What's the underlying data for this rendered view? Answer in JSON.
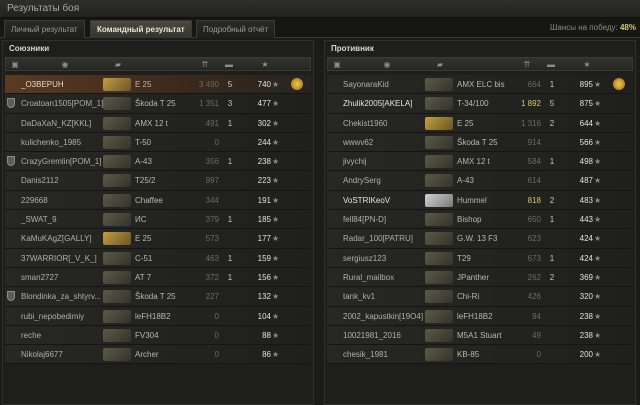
{
  "window": {
    "title": "Результаты боя"
  },
  "tabs": [
    {
      "label": "Личный результат"
    },
    {
      "label": "Командный результат"
    },
    {
      "label": "Подробный отчёт"
    }
  ],
  "win_chance": {
    "label": "Шансы на победу:",
    "value": "48%"
  },
  "allies": {
    "title": "Союзники",
    "header_icons": [
      "platoon-icon",
      "player-icon",
      "tank-icon",
      "damage-icon",
      "kills-icon",
      "experience-icon"
    ],
    "rows": [
      {
        "name": "_O3BEPUH",
        "vehicle": "E 25",
        "damage": "3 490",
        "kills": "5",
        "xp": "740",
        "platoon": false,
        "tank_style": "gold",
        "me": true,
        "medal": true
      },
      {
        "name": "Croatoan1505[POM_1]",
        "vehicle": "Škoda T 25",
        "damage": "1 351",
        "kills": "3",
        "xp": "477",
        "platoon": true,
        "tank_style": "normal"
      },
      {
        "name": "DaDaXaN_KZ[KKL]",
        "vehicle": "AMX 12 t",
        "damage": "491",
        "kills": "1",
        "xp": "302",
        "platoon": false,
        "tank_style": "normal"
      },
      {
        "name": "kulichenko_1985",
        "vehicle": "T-50",
        "damage": "0",
        "kills": "",
        "xp": "244",
        "platoon": false,
        "tank_style": "normal"
      },
      {
        "name": "CrazyGremlin[POM_1]",
        "vehicle": "A-43",
        "damage": "356",
        "kills": "1",
        "xp": "238",
        "platoon": true,
        "tank_style": "normal"
      },
      {
        "name": "Danis2112",
        "vehicle": "T25/2",
        "damage": "997",
        "kills": "",
        "xp": "223",
        "platoon": false,
        "tank_style": "normal"
      },
      {
        "name": "229668",
        "vehicle": "Chaffee",
        "damage": "344",
        "kills": "",
        "xp": "191",
        "platoon": false,
        "tank_style": "normal"
      },
      {
        "name": "_SWAT_9",
        "vehicle": "ИС",
        "damage": "379",
        "kills": "1",
        "xp": "185",
        "platoon": false,
        "tank_style": "normal"
      },
      {
        "name": "KaMuKAgZ[GALLY]",
        "vehicle": "E 25",
        "damage": "573",
        "kills": "",
        "xp": "177",
        "platoon": false,
        "tank_style": "gold"
      },
      {
        "name": "37WARRIOR[_V_K_]",
        "vehicle": "C-51",
        "damage": "463",
        "kills": "1",
        "xp": "159",
        "platoon": false,
        "tank_style": "normal"
      },
      {
        "name": "sman2727",
        "vehicle": "AT 7",
        "damage": "372",
        "kills": "1",
        "xp": "156",
        "platoon": false,
        "tank_style": "normal"
      },
      {
        "name": "Blondinka_za_shtyrv...",
        "vehicle": "Škoda T 25",
        "damage": "227",
        "kills": "",
        "xp": "132",
        "platoon": true,
        "tank_style": "normal"
      },
      {
        "name": "rubi_nepobedimiy",
        "vehicle": "leFH18B2",
        "damage": "0",
        "kills": "",
        "xp": "104",
        "platoon": false,
        "tank_style": "normal"
      },
      {
        "name": "reche",
        "vehicle": "FV304",
        "damage": "0",
        "kills": "",
        "xp": "88",
        "platoon": false,
        "tank_style": "normal"
      },
      {
        "name": "Nikolaj6677",
        "vehicle": "Archer",
        "damage": "0",
        "kills": "",
        "xp": "86",
        "platoon": false,
        "tank_style": "normal"
      }
    ]
  },
  "enemies": {
    "title": "Противник",
    "header_icons": [
      "platoon-icon",
      "player-icon",
      "tank-icon",
      "damage-icon",
      "kills-icon",
      "experience-icon"
    ],
    "rows": [
      {
        "name": "SayonaraKid",
        "vehicle": "AMX ELC bis",
        "damage": "664",
        "kills": "1",
        "xp": "895",
        "platoon": false,
        "tank_style": "normal",
        "medal": true
      },
      {
        "name": "Zhulik2005[AKELA]",
        "vehicle": "T-34/100",
        "damage": "1 892",
        "kills": "5",
        "xp": "875",
        "platoon": false,
        "tank_style": "normal",
        "bright": true,
        "dmg_hl": true
      },
      {
        "name": "Chekist1960",
        "vehicle": "E 25",
        "damage": "1 316",
        "kills": "2",
        "xp": "644",
        "platoon": false,
        "tank_style": "gold"
      },
      {
        "name": "wwwv62",
        "vehicle": "Škoda T 25",
        "damage": "914",
        "kills": "",
        "xp": "566",
        "platoon": false,
        "tank_style": "normal"
      },
      {
        "name": "jivychij",
        "vehicle": "AMX 12 t",
        "damage": "584",
        "kills": "1",
        "xp": "498",
        "platoon": false,
        "tank_style": "normal"
      },
      {
        "name": "AndrySerg",
        "vehicle": "A-43",
        "damage": "614",
        "kills": "",
        "xp": "487",
        "platoon": false,
        "tank_style": "normal"
      },
      {
        "name": "VoSTRIKeoV",
        "vehicle": "Hummel",
        "damage": "818",
        "kills": "2",
        "xp": "483",
        "platoon": false,
        "tank_style": "silver",
        "bright": true,
        "dmg_hl": true
      },
      {
        "name": "fell84[PN-D]",
        "vehicle": "Bishop",
        "damage": "650",
        "kills": "1",
        "xp": "443",
        "platoon": false,
        "tank_style": "normal"
      },
      {
        "name": "Radar_100[PATRU]",
        "vehicle": "G.W. 13 F3",
        "damage": "623",
        "kills": "",
        "xp": "424",
        "platoon": false,
        "tank_style": "normal"
      },
      {
        "name": "sergiusz123",
        "vehicle": "T29",
        "damage": "673",
        "kills": "1",
        "xp": "424",
        "platoon": false,
        "tank_style": "normal"
      },
      {
        "name": "Rural_mailbox",
        "vehicle": "JPanther",
        "damage": "262",
        "kills": "2",
        "xp": "369",
        "platoon": false,
        "tank_style": "normal"
      },
      {
        "name": "tank_kv1",
        "vehicle": "Chi-Ri",
        "damage": "426",
        "kills": "",
        "xp": "320",
        "platoon": false,
        "tank_style": "normal"
      },
      {
        "name": "2002_kapustkin[19O4]",
        "vehicle": "leFH18B2",
        "damage": "94",
        "kills": "",
        "xp": "238",
        "platoon": false,
        "tank_style": "normal"
      },
      {
        "name": "10021981_2016",
        "vehicle": "M5A1 Stuart",
        "damage": "49",
        "kills": "",
        "xp": "238",
        "platoon": false,
        "tank_style": "normal"
      },
      {
        "name": "chesik_1981",
        "vehicle": "KB-85",
        "damage": "0",
        "kills": "",
        "xp": "200",
        "platoon": false,
        "tank_style": "normal"
      }
    ]
  }
}
